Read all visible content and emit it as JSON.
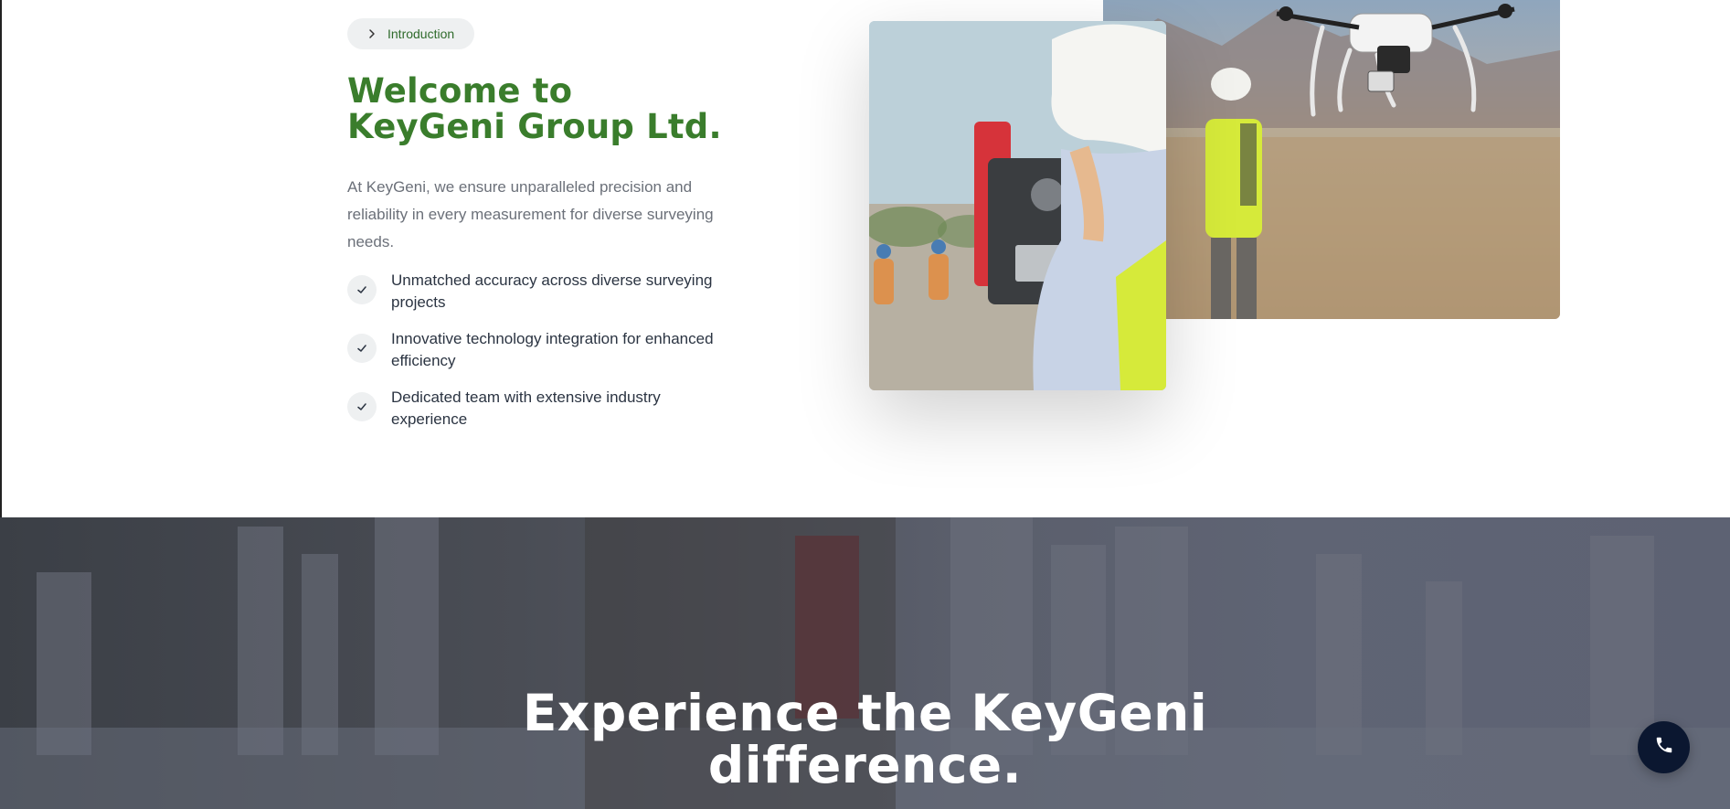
{
  "intro": {
    "badge_label": "Introduction",
    "title_line1": "Welcome to",
    "title_line2": "KeyGeni Group Ltd.",
    "description": "At KeyGeni, we ensure unparalleled precision and reliability in every measurement for diverse surveying needs.",
    "features": [
      {
        "label": "Unmatched accuracy across diverse surveying projects",
        "icon": "check-icon"
      },
      {
        "label": "Innovative technology integration for enhanced efficiency",
        "icon": "check-icon"
      },
      {
        "label": "Dedicated team with extensive industry experience",
        "icon": "check-icon"
      }
    ]
  },
  "images": {
    "front_image": "surveyor-with-total-station-photo",
    "back_image": "drone-over-worker-photo"
  },
  "hero": {
    "title_line1": "Experience the KeyGeni",
    "title_line2": "difference."
  },
  "call_button": {
    "icon": "phone-icon"
  },
  "colors": {
    "brand_green": "#3a7d2c",
    "badge_bg": "#eef0f1",
    "text_dark": "#2b3442",
    "text_muted": "#6b7079",
    "call_button_bg": "#0b1730"
  }
}
